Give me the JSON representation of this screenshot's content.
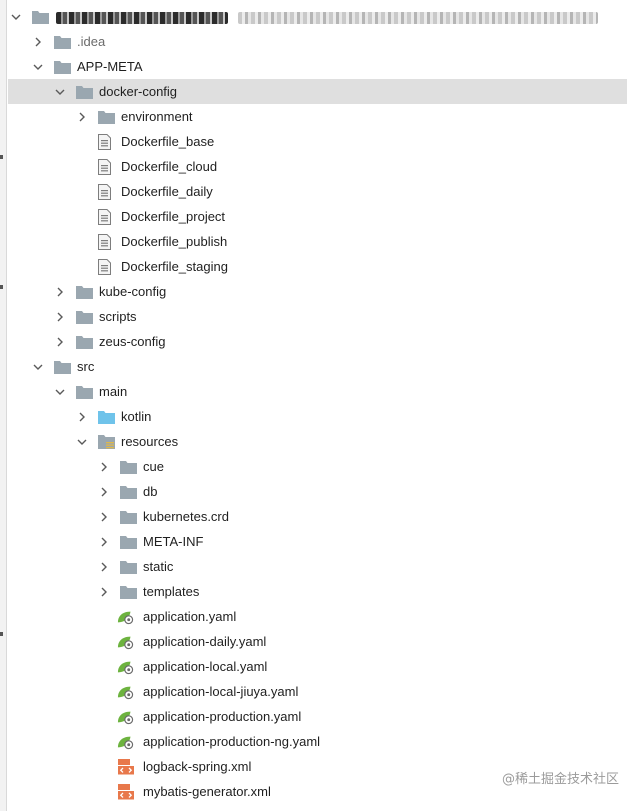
{
  "project_tree": {
    "root": {
      "name": "",
      "icon": "folder-icon"
    },
    "rows": [
      {
        "id": "idea",
        "label": ".idea",
        "depth": 1,
        "expand": "collapsed",
        "icon": "folder",
        "muted": true
      },
      {
        "id": "app-meta",
        "label": "APP-META",
        "depth": 1,
        "expand": "expanded",
        "icon": "folder"
      },
      {
        "id": "docker-config",
        "label": "docker-config",
        "depth": 2,
        "expand": "expanded",
        "icon": "folder",
        "selected": true
      },
      {
        "id": "environment",
        "label": "environment",
        "depth": 3,
        "expand": "collapsed",
        "icon": "folder"
      },
      {
        "id": "dockerfile-base",
        "label": "Dockerfile_base",
        "depth": 3,
        "expand": "none",
        "icon": "file"
      },
      {
        "id": "dockerfile-cloud",
        "label": "Dockerfile_cloud",
        "depth": 3,
        "expand": "none",
        "icon": "file"
      },
      {
        "id": "dockerfile-daily",
        "label": "Dockerfile_daily",
        "depth": 3,
        "expand": "none",
        "icon": "file"
      },
      {
        "id": "dockerfile-project",
        "label": "Dockerfile_project",
        "depth": 3,
        "expand": "none",
        "icon": "file"
      },
      {
        "id": "dockerfile-publish",
        "label": "Dockerfile_publish",
        "depth": 3,
        "expand": "none",
        "icon": "file"
      },
      {
        "id": "dockerfile-staging",
        "label": "Dockerfile_staging",
        "depth": 3,
        "expand": "none",
        "icon": "file"
      },
      {
        "id": "kube-config",
        "label": "kube-config",
        "depth": 2,
        "expand": "collapsed",
        "icon": "folder"
      },
      {
        "id": "scripts",
        "label": "scripts",
        "depth": 2,
        "expand": "collapsed",
        "icon": "folder"
      },
      {
        "id": "zeus-config",
        "label": "zeus-config",
        "depth": 2,
        "expand": "collapsed",
        "icon": "folder"
      },
      {
        "id": "src",
        "label": "src",
        "depth": 1,
        "expand": "expanded",
        "icon": "folder"
      },
      {
        "id": "main",
        "label": "main",
        "depth": 2,
        "expand": "expanded",
        "icon": "folder"
      },
      {
        "id": "kotlin",
        "label": "kotlin",
        "depth": 3,
        "expand": "collapsed",
        "icon": "source-folder"
      },
      {
        "id": "resources",
        "label": "resources",
        "depth": 3,
        "expand": "expanded",
        "icon": "resources-folder"
      },
      {
        "id": "cue",
        "label": "cue",
        "depth": 4,
        "expand": "collapsed",
        "icon": "folder"
      },
      {
        "id": "db",
        "label": "db",
        "depth": 4,
        "expand": "collapsed",
        "icon": "folder"
      },
      {
        "id": "kubernetes-crd",
        "label": "kubernetes.crd",
        "depth": 4,
        "expand": "collapsed",
        "icon": "folder"
      },
      {
        "id": "meta-inf",
        "label": "META-INF",
        "depth": 4,
        "expand": "collapsed",
        "icon": "folder"
      },
      {
        "id": "static",
        "label": "static",
        "depth": 4,
        "expand": "collapsed",
        "icon": "folder"
      },
      {
        "id": "templates",
        "label": "templates",
        "depth": 4,
        "expand": "collapsed",
        "icon": "folder"
      },
      {
        "id": "application-yaml",
        "label": "application.yaml",
        "depth": 4,
        "expand": "none",
        "icon": "spring-config"
      },
      {
        "id": "application-daily-yaml",
        "label": "application-daily.yaml",
        "depth": 4,
        "expand": "none",
        "icon": "spring-config"
      },
      {
        "id": "application-local-yaml",
        "label": "application-local.yaml",
        "depth": 4,
        "expand": "none",
        "icon": "spring-config"
      },
      {
        "id": "application-local-jiuya-yaml",
        "label": "application-local-jiuya.yaml",
        "depth": 4,
        "expand": "none",
        "icon": "spring-config"
      },
      {
        "id": "application-production-yaml",
        "label": "application-production.yaml",
        "depth": 4,
        "expand": "none",
        "icon": "spring-config"
      },
      {
        "id": "application-production-ng-yaml",
        "label": "application-production-ng.yaml",
        "depth": 4,
        "expand": "none",
        "icon": "spring-config"
      },
      {
        "id": "logback-spring-xml",
        "label": "logback-spring.xml",
        "depth": 4,
        "expand": "none",
        "icon": "xml-file"
      },
      {
        "id": "mybatis-generator-xml",
        "label": "mybatis-generator.xml",
        "depth": 4,
        "expand": "none",
        "icon": "xml-file"
      }
    ]
  },
  "watermark": {
    "text": "@稀土掘金技术社区"
  },
  "colors": {
    "folder": "#9aa7b0",
    "source_folder": "#6fc3ea",
    "selection": "#dfdfdf",
    "spring": "#6db33f",
    "xml": "#e8784b",
    "muted_text": "#6b6b6b"
  }
}
